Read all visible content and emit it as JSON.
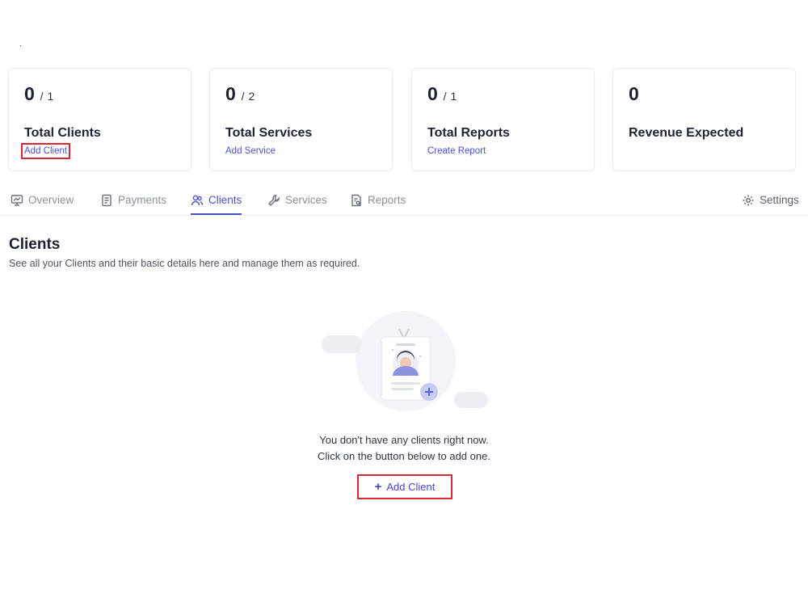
{
  "stats": [
    {
      "value": "0",
      "max": "1",
      "label": "Total Clients",
      "link": "Add Client"
    },
    {
      "value": "0",
      "max": "2",
      "label": "Total Services",
      "link": "Add Service"
    },
    {
      "value": "0",
      "max": "1",
      "label": "Total Reports",
      "link": "Create Report"
    },
    {
      "value": "0",
      "label": "Revenue Expected"
    }
  ],
  "tabs": [
    {
      "label": "Overview",
      "icon": "presentation-icon"
    },
    {
      "label": "Payments",
      "icon": "receipt-icon"
    },
    {
      "label": "Clients",
      "icon": "users-icon",
      "active": true
    },
    {
      "label": "Services",
      "icon": "wrench-icon"
    },
    {
      "label": "Reports",
      "icon": "report-icon"
    }
  ],
  "settings": {
    "label": "Settings",
    "icon": "gear-icon"
  },
  "section": {
    "title": "Clients",
    "subtitle": "See all your Clients and their basic details here and manage them as required."
  },
  "empty_state": {
    "line1": "You don't have any clients right now.",
    "line2": "Click on the button below to add one.",
    "button": "Add Client"
  },
  "colors": {
    "accent": "#4a52c9",
    "highlight": "#d42a36",
    "text": "#1f2433",
    "muted": "#8a8f9c"
  }
}
